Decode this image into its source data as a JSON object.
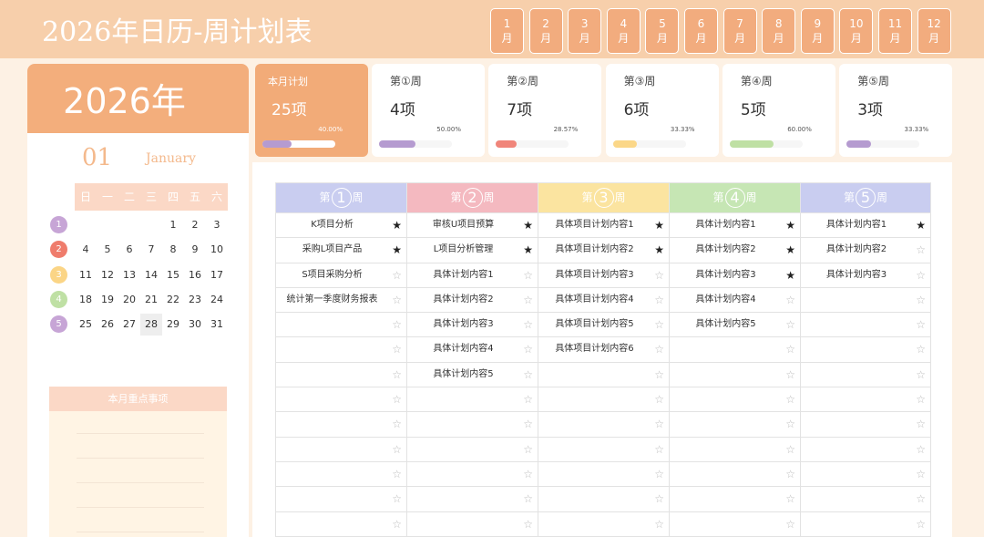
{
  "title": "2026年日历-周计划表",
  "months": [
    {
      "num": "1",
      "unit": "月"
    },
    {
      "num": "2",
      "unit": "月"
    },
    {
      "num": "3",
      "unit": "月"
    },
    {
      "num": "4",
      "unit": "月"
    },
    {
      "num": "5",
      "unit": "月"
    },
    {
      "num": "6",
      "unit": "月"
    },
    {
      "num": "7",
      "unit": "月"
    },
    {
      "num": "8",
      "unit": "月"
    },
    {
      "num": "9",
      "unit": "月"
    },
    {
      "num": "10",
      "unit": "月"
    },
    {
      "num": "11",
      "unit": "月"
    },
    {
      "num": "12",
      "unit": "月"
    }
  ],
  "year": "2026年",
  "month_num": "01",
  "month_name": "January",
  "weekday_headers": [
    "日",
    "一",
    "二",
    "三",
    "四",
    "五",
    "六"
  ],
  "calendar": {
    "week_numbers": [
      "1",
      "2",
      "3",
      "4",
      "5"
    ],
    "week_colors": [
      "#c7a5d6",
      "#ef7c6c",
      "#fbd586",
      "#bfe0a4",
      "#c7a5d6"
    ],
    "rows": [
      [
        "",
        "",
        "",
        "",
        "1",
        "2",
        "3"
      ],
      [
        "4",
        "5",
        "6",
        "7",
        "8",
        "9",
        "10"
      ],
      [
        "11",
        "12",
        "13",
        "14",
        "15",
        "16",
        "17"
      ],
      [
        "18",
        "19",
        "20",
        "21",
        "22",
        "23",
        "24"
      ],
      [
        "25",
        "26",
        "27",
        "28",
        "29",
        "30",
        "31"
      ]
    ],
    "today": "28"
  },
  "notes_title": "本月重点事项",
  "summary": {
    "label": "本月计划",
    "count": "25项",
    "pct": "40.00%",
    "progress": 0.4,
    "bar_color": "#b59bd0"
  },
  "week_cards": [
    {
      "label": "第①周",
      "count": "4项",
      "pct": "50.00%",
      "progress": 0.5,
      "bar_color": "#b59bd0"
    },
    {
      "label": "第②周",
      "count": "7项",
      "pct": "28.57%",
      "progress": 0.2857,
      "bar_color": "#f0857a"
    },
    {
      "label": "第③周",
      "count": "6项",
      "pct": "33.33%",
      "progress": 0.3333,
      "bar_color": "#fbd788"
    },
    {
      "label": "第④周",
      "count": "5项",
      "pct": "60.00%",
      "progress": 0.6,
      "bar_color": "#bfe0a4"
    },
    {
      "label": "第⑤周",
      "count": "3项",
      "pct": "33.33%",
      "progress": 0.3333,
      "bar_color": "#b59bd0"
    }
  ],
  "table": {
    "columns": [
      {
        "pre": "第",
        "num": "1",
        "post": "周",
        "color": "#c9cdf0"
      },
      {
        "pre": "第",
        "num": "2",
        "post": "周",
        "color": "#f4b9c0"
      },
      {
        "pre": "第",
        "num": "3",
        "post": "周",
        "color": "#fbe4a0"
      },
      {
        "pre": "第",
        "num": "4",
        "post": "周",
        "color": "#c6e6b4"
      },
      {
        "pre": "第",
        "num": "5",
        "post": "周",
        "color": "#c9cdf0"
      }
    ],
    "rows": [
      [
        {
          "text": "K项目分析",
          "star": true
        },
        {
          "text": "审核U项目预算",
          "star": true
        },
        {
          "text": "具体项目计划内容1",
          "star": true
        },
        {
          "text": "具体计划内容1",
          "star": true
        },
        {
          "text": "具体计划内容1",
          "star": true
        }
      ],
      [
        {
          "text": "采购L项目产品",
          "star": true
        },
        {
          "text": "L项目分析管理",
          "star": true
        },
        {
          "text": "具体项目计划内容2",
          "star": true
        },
        {
          "text": "具体计划内容2",
          "star": true
        },
        {
          "text": "具体计划内容2",
          "star": false
        }
      ],
      [
        {
          "text": "S项目采购分析",
          "star": false
        },
        {
          "text": "具体计划内容1",
          "star": false
        },
        {
          "text": "具体项目计划内容3",
          "star": false
        },
        {
          "text": "具体计划内容3",
          "star": true
        },
        {
          "text": "具体计划内容3",
          "star": false
        }
      ],
      [
        {
          "text": "统计第一季度财务报表",
          "star": false
        },
        {
          "text": "具体计划内容2",
          "star": false
        },
        {
          "text": "具体项目计划内容4",
          "star": false
        },
        {
          "text": "具体计划内容4",
          "star": false
        },
        {
          "text": "",
          "star": false
        }
      ],
      [
        {
          "text": "",
          "star": false
        },
        {
          "text": "具体计划内容3",
          "star": false
        },
        {
          "text": "具体项目计划内容5",
          "star": false
        },
        {
          "text": "具体计划内容5",
          "star": false
        },
        {
          "text": "",
          "star": false
        }
      ],
      [
        {
          "text": "",
          "star": false
        },
        {
          "text": "具体计划内容4",
          "star": false
        },
        {
          "text": "具体项目计划内容6",
          "star": false
        },
        {
          "text": "",
          "star": false
        },
        {
          "text": "",
          "star": false
        }
      ],
      [
        {
          "text": "",
          "star": false
        },
        {
          "text": "具体计划内容5",
          "star": false
        },
        {
          "text": "",
          "star": false
        },
        {
          "text": "",
          "star": false
        },
        {
          "text": "",
          "star": false
        }
      ],
      [
        {
          "text": "",
          "star": false
        },
        {
          "text": "",
          "star": false
        },
        {
          "text": "",
          "star": false
        },
        {
          "text": "",
          "star": false
        },
        {
          "text": "",
          "star": false
        }
      ],
      [
        {
          "text": "",
          "star": false
        },
        {
          "text": "",
          "star": false
        },
        {
          "text": "",
          "star": false
        },
        {
          "text": "",
          "star": false
        },
        {
          "text": "",
          "star": false
        }
      ],
      [
        {
          "text": "",
          "star": false
        },
        {
          "text": "",
          "star": false
        },
        {
          "text": "",
          "star": false
        },
        {
          "text": "",
          "star": false
        },
        {
          "text": "",
          "star": false
        }
      ],
      [
        {
          "text": "",
          "star": false
        },
        {
          "text": "",
          "star": false
        },
        {
          "text": "",
          "star": false
        },
        {
          "text": "",
          "star": false
        },
        {
          "text": "",
          "star": false
        }
      ],
      [
        {
          "text": "",
          "star": false
        },
        {
          "text": "",
          "star": false
        },
        {
          "text": "",
          "star": false
        },
        {
          "text": "",
          "star": false
        },
        {
          "text": "",
          "star": false
        }
      ],
      [
        {
          "text": "",
          "star": false
        },
        {
          "text": "",
          "star": false
        },
        {
          "text": "",
          "star": false
        },
        {
          "text": "",
          "star": false
        },
        {
          "text": "",
          "star": false
        }
      ]
    ]
  },
  "icons": {
    "star_filled": "star-filled-icon",
    "star_empty": "star-empty-icon"
  }
}
